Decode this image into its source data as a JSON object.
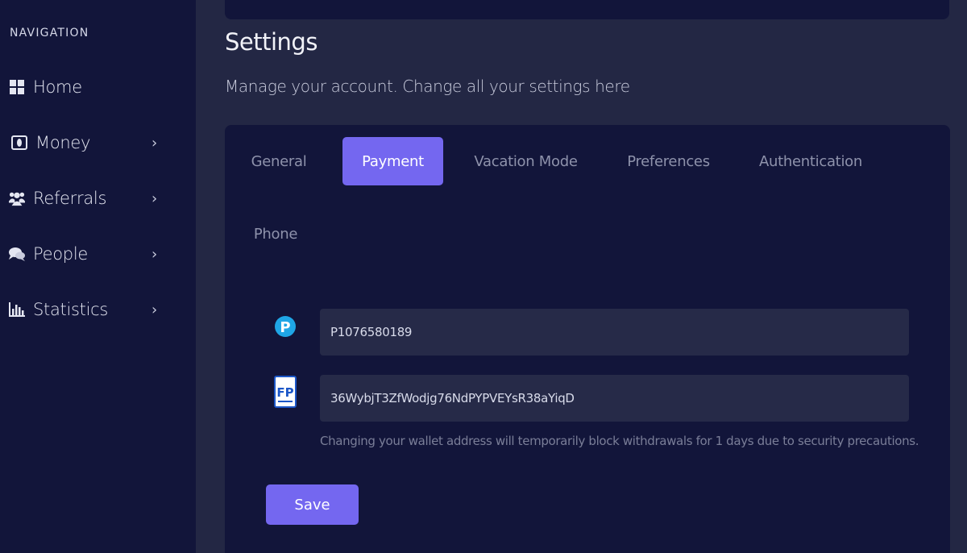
{
  "sidebar": {
    "heading": "NAVIGATION",
    "items": [
      {
        "label": "Home",
        "icon": "grid-icon",
        "chevron": ""
      },
      {
        "label": "Money",
        "icon": "money-icon",
        "chevron": "›"
      },
      {
        "label": "Referrals",
        "icon": "users-icon",
        "chevron": "›"
      },
      {
        "label": "People",
        "icon": "chat-bubbles-icon",
        "chevron": "›"
      },
      {
        "label": "Statistics",
        "icon": "bar-chart-icon",
        "chevron": "›"
      }
    ]
  },
  "page": {
    "title": "Settings",
    "subtitle": "Manage your account. Change all your settings here"
  },
  "tabs": [
    {
      "label": "General",
      "active": false
    },
    {
      "label": "Payment",
      "active": true
    },
    {
      "label": "Vacation Mode",
      "active": false
    },
    {
      "label": "Preferences",
      "active": false
    },
    {
      "label": "Authentication",
      "active": false
    },
    {
      "label": "Phone",
      "active": false
    }
  ],
  "wallets": [
    {
      "icon": "payeer-logo-icon",
      "logo_letter": "P",
      "value": "P1076580189"
    },
    {
      "icon": "faucetpay-logo-icon",
      "logo_letter": "FP",
      "value": "36WybjT3ZfWodjg76NdPYPVEYsR38aYiqD"
    }
  ],
  "help_text": "Changing your wallet address will temporarily block withdrawals for 1 days due to security precautions.",
  "save_label": "Save",
  "colors": {
    "background": "#232744",
    "sidebar": "#12153a",
    "panel": "#12153a",
    "accent": "#7467f0",
    "input": "#262a48"
  }
}
